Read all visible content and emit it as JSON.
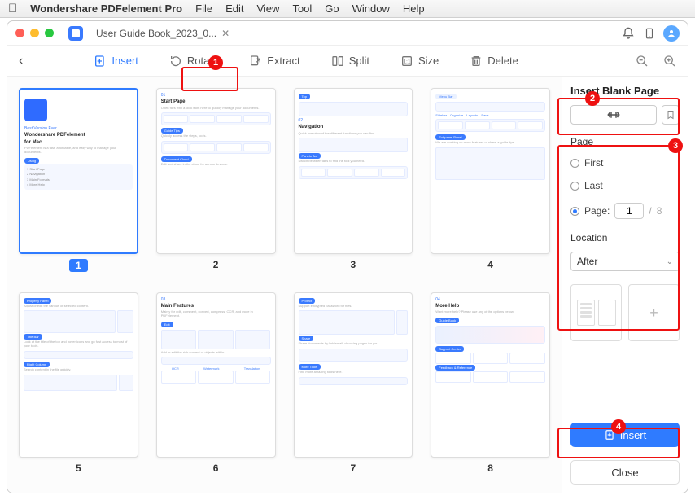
{
  "menubar": {
    "appname": "Wondershare PDFelement Pro",
    "items": [
      "File",
      "Edit",
      "View",
      "Tool",
      "Go",
      "Window",
      "Help"
    ]
  },
  "tab": {
    "title": "User Guide Book_2023_0..."
  },
  "toolbar": {
    "insert": "Insert",
    "rotate": "Rotate",
    "extract": "Extract",
    "split": "Split",
    "size": "Size",
    "delete": "Delete"
  },
  "pages": {
    "labels": [
      "1",
      "2",
      "3",
      "4",
      "5",
      "6",
      "7",
      "8"
    ],
    "thumbs": {
      "p1": {
        "pre": "Best Version Ever",
        "title1": "Wondershare PDFelement",
        "title2": "for Mac",
        "toc": [
          "1  Start Page",
          "2  Navigation",
          "3  Main Formats",
          "4  More Help"
        ]
      },
      "p2": {
        "h1": "01",
        "t1": "Start Page",
        "tag1": "Guide Tips",
        "tag2": "Document Cloud"
      },
      "p3": {
        "tag1": "Top",
        "h1": "02",
        "t1": "Navigation",
        "tag2": "Panels Bar"
      },
      "p4": {
        "tag1": "Menu Bar",
        "labels": [
          "Sidebar",
          "Organize",
          "Layouts",
          "Save"
        ],
        "tag2": "Subpanel Panel"
      },
      "p5": {
        "tag1": "Property Panel",
        "tag2": "Title Bar",
        "tag3": "Right Column"
      },
      "p6": {
        "h1": "03",
        "t1": "Main Features",
        "tag1": "Edit",
        "labels": [
          "OCR",
          "Watermark",
          "Translation"
        ]
      },
      "p7": {
        "tag1": "Protect",
        "tag2": "Share",
        "tag3": "More Tools"
      },
      "p8": {
        "h1": "04",
        "t1": "More Help",
        "tag1": "Guide Book",
        "tag2": "Support Center",
        "tag3": "Feedback & Reference"
      }
    }
  },
  "rightPanel": {
    "title": "Insert Blank Page",
    "section_page": "Page",
    "opt_first": "First",
    "opt_last": "Last",
    "opt_page": "Page:",
    "page_value": "1",
    "page_total": "8",
    "section_location": "Location",
    "location_value": "After",
    "btn_insert": "Insert",
    "btn_close": "Close"
  },
  "callouts": {
    "c1": "1",
    "c2": "2",
    "c3": "3",
    "c4": "4"
  }
}
